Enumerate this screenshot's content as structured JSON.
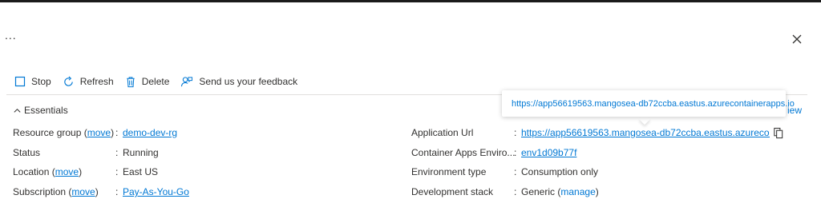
{
  "header": {
    "more_label": "...",
    "close_icon": "close-icon"
  },
  "toolbar": {
    "stop_label": "Stop",
    "refresh_label": "Refresh",
    "delete_label": "Delete",
    "feedback_label": "Send us your feedback"
  },
  "essentials": {
    "title": "Essentials",
    "json_view_label": "iew",
    "left": [
      {
        "label": "Resource group",
        "action": "move",
        "value": "demo-dev-rg",
        "value_is_link": true
      },
      {
        "label": "Status",
        "value": "Running"
      },
      {
        "label": "Location",
        "action": "move",
        "value": "East US"
      },
      {
        "label": "Subscription",
        "action": "move",
        "value": "Pay-As-You-Go",
        "value_is_link": true
      }
    ],
    "right": [
      {
        "label": "Application Url",
        "value": "https://app56619563.mangosea-db72ccba.eastus.azurecont...",
        "value_is_link": true
      },
      {
        "label": "Container Apps Enviro...",
        "value": "env1d09b77f",
        "value_is_link": true
      },
      {
        "label": "Environment type",
        "value": "Consumption only"
      },
      {
        "label": "Development stack",
        "value": "Generic",
        "action": "manage"
      }
    ]
  },
  "tooltip": {
    "text": "https://app56619563.mangosea-db72ccba.eastus.azurecontainerapps.io"
  },
  "colors": {
    "link": "#0078d4",
    "text": "#323130",
    "divider": "#e1dfdd"
  }
}
